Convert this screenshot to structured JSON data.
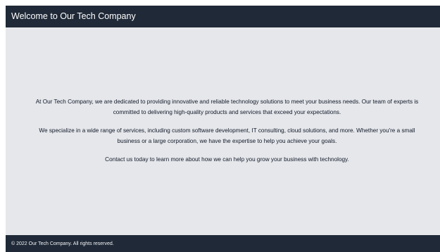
{
  "header": {
    "title": "Welcome to Our Tech Company"
  },
  "main": {
    "paragraphs": [
      "At Our Tech Company, we are dedicated to providing innovative and reliable technology solutions to meet your business needs. Our team of experts is committed to delivering high-quality products and services that exceed your expectations.",
      "We specialize in a wide range of services, including custom software development, IT consulting, cloud solutions, and more. Whether you're a small business or a large corporation, we have the expertise to help you achieve your goals.",
      "Contact us today to learn more about how we can help you grow your business with technology."
    ]
  },
  "footer": {
    "text": "© 2022 Our Tech Company. All rights reserved."
  },
  "colors": {
    "header_bg": "#1f2937",
    "body_bg": "#e5e7eb",
    "text": "#111827",
    "footer_text": "#f3f4f6"
  }
}
